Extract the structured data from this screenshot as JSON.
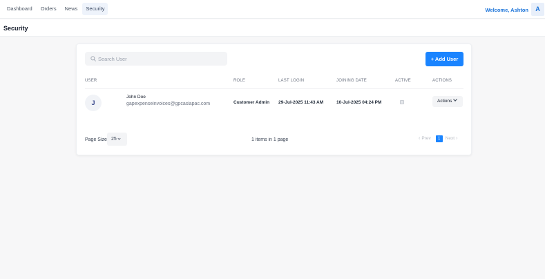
{
  "nav": {
    "items": [
      {
        "label": "Dashboard"
      },
      {
        "label": "Orders"
      },
      {
        "label": "News"
      },
      {
        "label": "Security"
      }
    ],
    "active": "Security"
  },
  "header": {
    "welcome": "Welcome, Ashton",
    "avatar_initial": "A"
  },
  "page": {
    "title": "Security"
  },
  "search": {
    "placeholder": "Search User",
    "value": ""
  },
  "toolbar": {
    "add_user_label": "+ Add User"
  },
  "table": {
    "columns": [
      "USER",
      "ROLE",
      "LAST LOGIN",
      "JOINING DATE",
      "ACTIVE",
      "ACTIONS"
    ],
    "rows": [
      {
        "initial": "J",
        "name": "John Doe",
        "email": "gapexpenseinvoices@gpcasiapac.com",
        "role": "Customer Admin",
        "last_login": "29-Jul-2025 11:43 AM",
        "joining_date": "10-Jul-2025 04:24 PM",
        "active": false,
        "actions_label": "Actions"
      }
    ]
  },
  "pagination": {
    "page_size_label": "Page Size",
    "page_size": "25",
    "summary": "1 items in 1 page",
    "prev_label": "Prev",
    "next_label": "Next",
    "current_page": "1"
  },
  "colors": {
    "accent": "#1a84ff",
    "link": "#1a73d9"
  }
}
